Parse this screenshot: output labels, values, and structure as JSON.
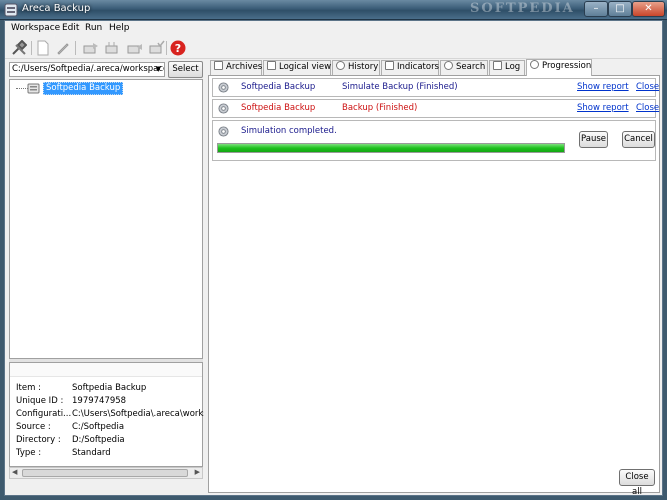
{
  "window": {
    "title": "Areca Backup",
    "watermark": "SOFTPEDIA"
  },
  "menu": [
    "Workspace",
    "Edit",
    "Run",
    "Help"
  ],
  "toolbar": {
    "icons": [
      "tools-icon",
      "new-document-icon",
      "edit-pencil-icon",
      "backup-icon",
      "merge-icon",
      "recover-icon",
      "check-icon",
      "help-icon"
    ]
  },
  "left": {
    "workspace_path": "C:/Users/Softpedia/.areca/workspace",
    "select_label": "Select ...",
    "tree": {
      "item": "Softpedia Backup"
    },
    "properties": [
      {
        "key": "Item :",
        "value": "Softpedia Backup"
      },
      {
        "key": "Unique ID :",
        "value": "1979747958"
      },
      {
        "key": "Configurati...",
        "value": "C:\\Users\\Softpedia\\.areca\\worksp..."
      },
      {
        "key": "Source :",
        "value": "C:/Softpedia"
      },
      {
        "key": "Directory :",
        "value": "D:/Softpedia"
      },
      {
        "key": "Type :",
        "value": "Standard"
      }
    ]
  },
  "tabs": [
    "Archives",
    "Logical view",
    "History",
    "Indicators",
    "Search",
    "Log",
    "Progression"
  ],
  "progression": {
    "rows": [
      {
        "name": "Softpedia Backup",
        "status": "Simulate Backup (Finished)",
        "show_report": "Show report",
        "close": "Close",
        "color": "#1a1a8c"
      },
      {
        "name": "Softpedia Backup",
        "status": "Backup (Finished)",
        "show_report": "Show report",
        "close": "Close",
        "color": "#cc1111"
      }
    ],
    "current": {
      "message": "Simulation completed.",
      "progress": 1.0,
      "pause_label": "Pause",
      "cancel_label": "Cancel"
    },
    "close_all_label": "Close all"
  },
  "colors": {
    "accent": "#3399ff",
    "link": "#0033cc",
    "progress": "#1ec21e"
  }
}
